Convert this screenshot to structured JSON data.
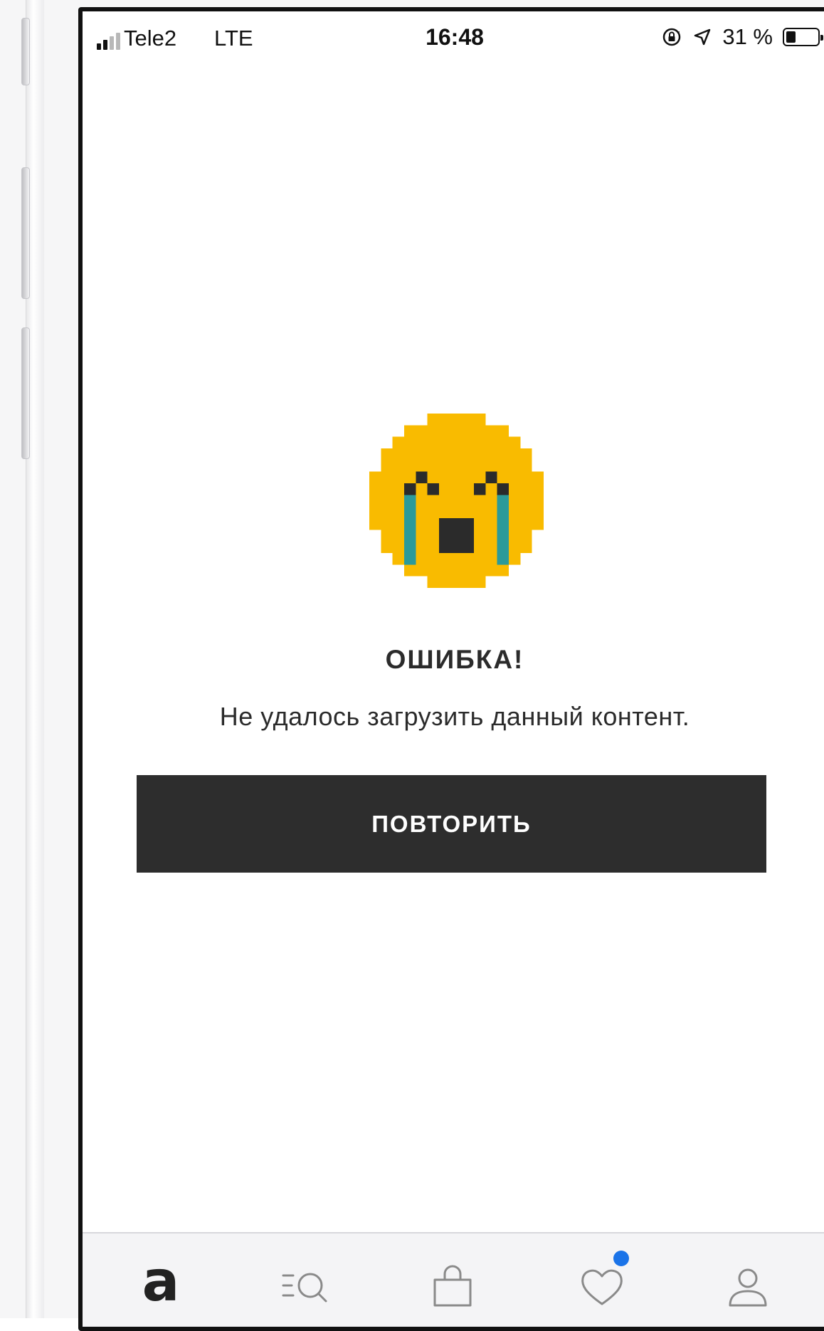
{
  "status_bar": {
    "carrier": "Tele2",
    "network": "LTE",
    "time": "16:48",
    "battery": "31 %",
    "battery_level": 0.31
  },
  "error": {
    "emoji": "crying-face-icon",
    "title": "ОШИБКА!",
    "message": "Не удалось загрузить данный контент.",
    "retry_label": "ПОВТОРИТЬ"
  },
  "tab_bar": {
    "logo": "a",
    "items": [
      "home-logo",
      "catalog-search-icon",
      "bag-icon",
      "favorites-heart-icon",
      "profile-icon"
    ],
    "badge_color": "#1a73e8"
  },
  "colors": {
    "emoji_yellow": "#f9bb00",
    "tear": "#2b9a9a",
    "button": "#2d2d2d"
  }
}
